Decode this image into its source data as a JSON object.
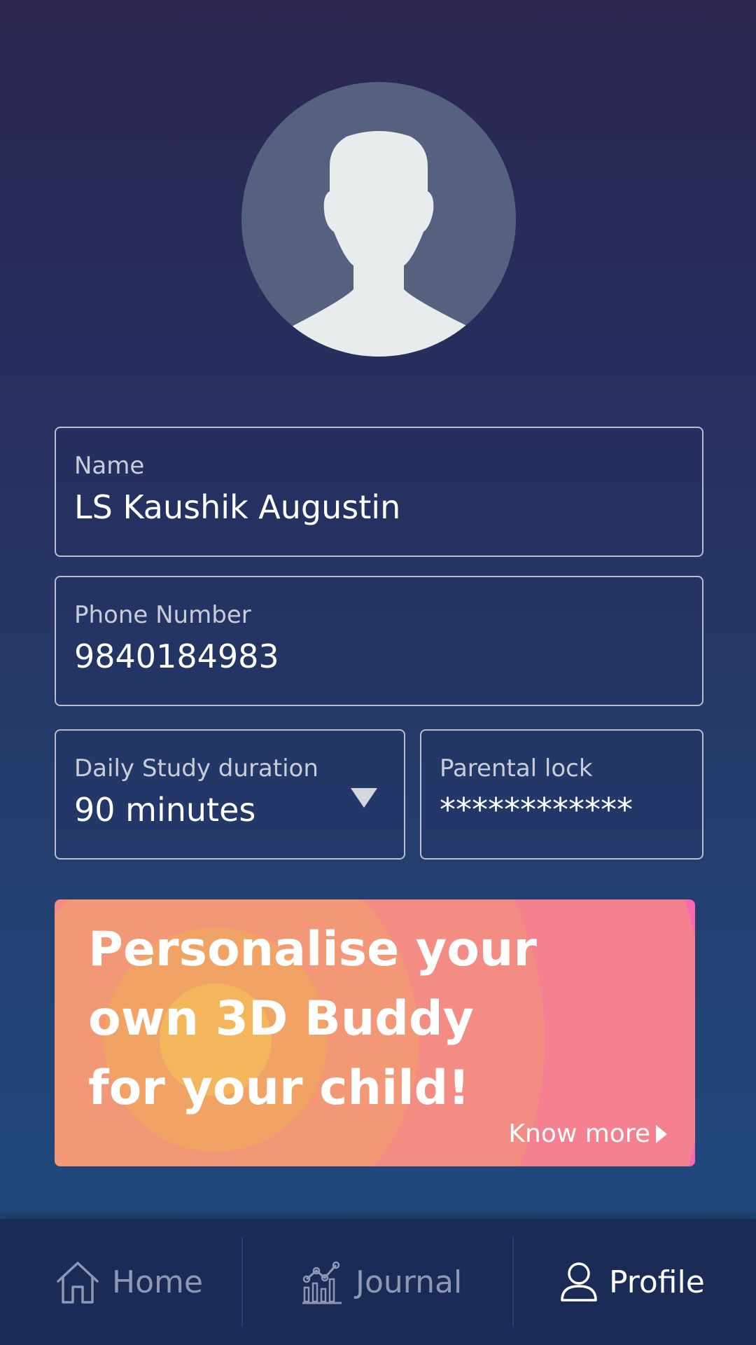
{
  "profile": {
    "name_field": {
      "label": "Name",
      "value": "LS Kaushik Augustin"
    },
    "phone_field": {
      "label": "Phone Number",
      "value": "9840184983"
    },
    "study_field": {
      "label": "Daily Study duration",
      "value": "90 minutes"
    },
    "lock_field": {
      "label": "Parental lock",
      "value": "************"
    }
  },
  "promo": {
    "line1": "Personalise your",
    "line2": "own 3D Buddy",
    "line3": "for your child!",
    "link": "Know more"
  },
  "nav": {
    "home": "Home",
    "journal": "Journal",
    "profile": "Profile",
    "active": "profile"
  },
  "icons": {
    "avatar": "user-silhouette-icon",
    "dropdown": "chevron-down-icon",
    "link": "play-arrow-icon",
    "home": "home-icon",
    "journal": "chart-icon",
    "profile": "user-icon"
  },
  "colors": {
    "accent_pink": "#f966b2",
    "active_nav": "#ffffff",
    "inactive_nav": "#8e98b4"
  }
}
